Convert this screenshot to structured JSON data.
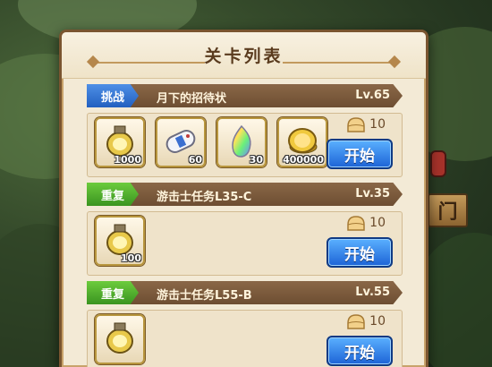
{
  "panel": {
    "title": "关卡列表"
  },
  "background": {
    "side_sign_text": "门"
  },
  "stages": [
    {
      "tag": "挑战",
      "tag_color": "blue",
      "name": "月下的招待状",
      "level": "Lv.65",
      "cost": "10",
      "start_label": "开始",
      "rewards": [
        {
          "icon": "gold-crystal-icon",
          "qty": "1000"
        },
        {
          "icon": "bandage-icon",
          "qty": "60"
        },
        {
          "icon": "rainbow-gem-icon",
          "qty": "30"
        },
        {
          "icon": "gold-coin-icon",
          "qty": "400000"
        }
      ]
    },
    {
      "tag": "重复",
      "tag_color": "green",
      "name": "游击士任务L35-C",
      "level": "Lv.35",
      "cost": "10",
      "start_label": "开始",
      "rewards": [
        {
          "icon": "gold-crystal-icon",
          "qty": "100"
        }
      ]
    },
    {
      "tag": "重复",
      "tag_color": "green",
      "name": "游击士任务L55-B",
      "level": "Lv.55",
      "cost": "10",
      "start_label": "开始",
      "rewards": [
        {
          "icon": "gold-crystal-icon",
          "qty": ""
        }
      ]
    }
  ],
  "colors": {
    "challenge": "#2f73d8",
    "repeat": "#4aa82a",
    "bar": "#7a5a3c",
    "panel": "#f3ead6"
  }
}
